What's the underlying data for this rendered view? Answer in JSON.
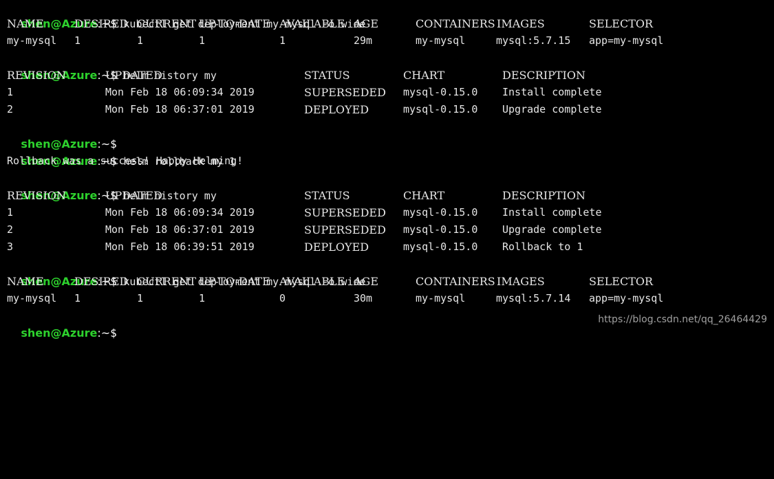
{
  "prompt": {
    "user_host": "shen@Azure",
    "path": ":~",
    "symbol": "$ "
  },
  "colors": {
    "background": "#000000",
    "prompt": "#2dd12d",
    "text": "#e6e6e6"
  },
  "commands": [
    "kubectl get deployment my-mysql -o wide",
    "helm history my",
    "",
    "helm rollback my 1",
    "helm history my",
    "kubectl get deployment my-mysql -o wide",
    ""
  ],
  "deployment_headers": [
    "NAME",
    "DESIRED",
    "CURRENT",
    "UP-TO-DATE",
    "AVAILABLE",
    "AGE",
    "CONTAINERS",
    "IMAGES",
    "SELECTOR"
  ],
  "deployment_before": [
    "my-mysql",
    "1",
    "1",
    "1",
    "1",
    "29m",
    "my-mysql",
    "mysql:5.7.15",
    "app=my-mysql"
  ],
  "deployment_after": [
    "my-mysql",
    "1",
    "1",
    "1",
    "0",
    "30m",
    "my-mysql",
    "mysql:5.7.14",
    "app=my-mysql"
  ],
  "history_headers": [
    "REVISION",
    "UPDATED",
    "STATUS",
    "CHART",
    "DESCRIPTION"
  ],
  "history_first": [
    [
      "1",
      "Mon Feb 18 06:09:34 2019",
      "SUPERSEDED",
      "mysql-0.15.0",
      "Install complete"
    ],
    [
      "2",
      "Mon Feb 18 06:37:01 2019",
      "DEPLOYED",
      "mysql-0.15.0",
      "Upgrade complete"
    ]
  ],
  "rollback_message": "Rollback was a success! Happy Helming!",
  "history_second": [
    [
      "1",
      "Mon Feb 18 06:09:34 2019",
      "SUPERSEDED",
      "mysql-0.15.0",
      "Install complete"
    ],
    [
      "2",
      "Mon Feb 18 06:37:01 2019",
      "SUPERSEDED",
      "mysql-0.15.0",
      "Upgrade complete"
    ],
    [
      "3",
      "Mon Feb 18 06:39:51 2019",
      "DEPLOYED",
      "mysql-0.15.0",
      "Rollback to 1"
    ]
  ],
  "watermark": "https://blog.csdn.net/qq_26464429"
}
